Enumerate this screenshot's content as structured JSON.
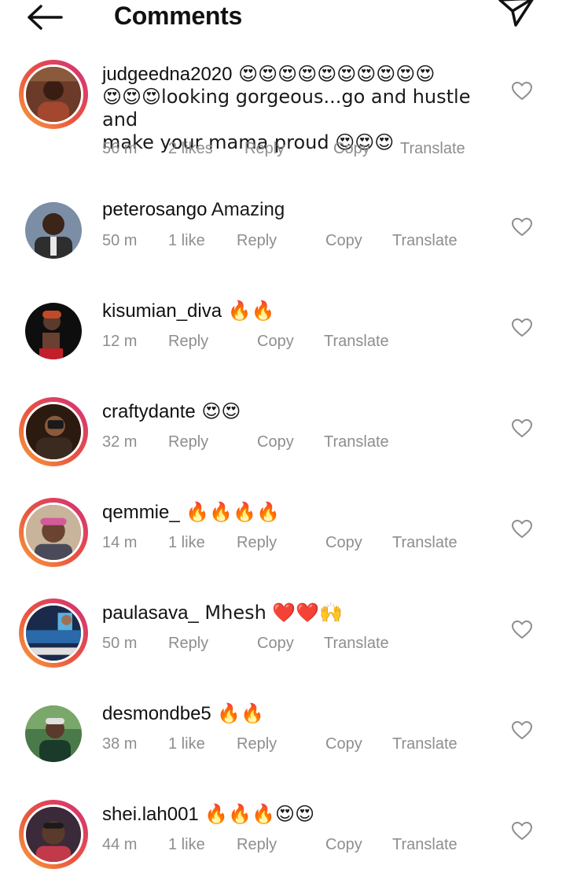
{
  "header": {
    "title": "Comments"
  },
  "comments": [
    {
      "username": "judgeedna2020",
      "text_line1": " 😍😍😍😍😍😍😍😍😍😍",
      "text_line2": "😍😍😍looking gorgeous...go and hustle and",
      "text_line3": "make your mama proud 😍😍😍",
      "time": "56 m",
      "likes": "2 likes",
      "reply": "Reply",
      "copy": "Copy",
      "translate": "Translate"
    },
    {
      "username": "peterosango",
      "text": " Amazing",
      "time": "50 m",
      "likes": "1 like",
      "reply": "Reply",
      "copy": "Copy",
      "translate": "Translate"
    },
    {
      "username": "kisumian_diva",
      "text": " 🔥🔥",
      "time": "12 m",
      "reply": "Reply",
      "copy": "Copy",
      "translate": "Translate"
    },
    {
      "username": "craftydante",
      "text": " 😍😍",
      "time": "32 m",
      "reply": "Reply",
      "copy": "Copy",
      "translate": "Translate"
    },
    {
      "username": "qemmie_",
      "text": " 🔥🔥🔥🔥",
      "time": "14 m",
      "likes": "1 like",
      "reply": "Reply",
      "copy": "Copy",
      "translate": "Translate"
    },
    {
      "username": "paulasava_",
      "text": " Mhesh ❤️❤️🙌",
      "time": "50 m",
      "reply": "Reply",
      "copy": "Copy",
      "translate": "Translate"
    },
    {
      "username": "desmondbe5",
      "text": " 🔥🔥",
      "time": "38 m",
      "likes": "1 like",
      "reply": "Reply",
      "copy": "Copy",
      "translate": "Translate"
    },
    {
      "username": "shei.lah001",
      "text": " 🔥🔥🔥😍😍",
      "time": "44 m",
      "likes": "1 like",
      "reply": "Reply",
      "copy": "Copy",
      "translate": "Translate"
    }
  ],
  "icons": {
    "back": "arrow-left-icon",
    "send": "paper-plane-icon",
    "like": "heart-outline-icon"
  },
  "colors": {
    "meta_text": "#8e8e8e",
    "story_ring_start": "#f9a13b",
    "story_ring_end": "#d12f7c"
  }
}
